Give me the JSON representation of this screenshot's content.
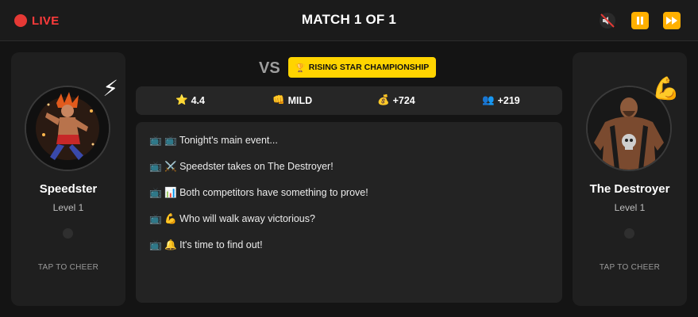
{
  "header": {
    "live_label": "LIVE",
    "title": "MATCH 1 OF 1",
    "mute_icon": "🔇",
    "fastforward_icon": "⏩"
  },
  "left_fighter": {
    "name": "Speedster",
    "level": "Level 1",
    "badge_icon": "⚡",
    "cheer_label": "TAP TO CHEER"
  },
  "right_fighter": {
    "name": "The Destroyer",
    "level": "Level 1",
    "badge_icon": "💪",
    "cheer_label": "TAP TO CHEER"
  },
  "versus": {
    "vs_label": "VS",
    "championship_icon": "🏆",
    "championship": "RISING STAR CHAMPIONSHIP"
  },
  "stats": [
    {
      "icon": "⭐",
      "value": "4.4"
    },
    {
      "icon": "👊",
      "value": "MILD"
    },
    {
      "icon": "💰",
      "value": "+724"
    },
    {
      "icon": "👥",
      "value": "+219"
    }
  ],
  "feed": [
    "📺 📺 Tonight's main event...",
    "📺 ⚔️ Speedster takes on The Destroyer!",
    "📺 📊 Both competitors have something to prove!",
    "📺 💪 Who will walk away victorious?",
    "📺 🔔 It's time to find out!"
  ],
  "colors": {
    "live": "#ff3b3b",
    "accent": "#ffb000",
    "championship_badge": "#ffd400"
  }
}
